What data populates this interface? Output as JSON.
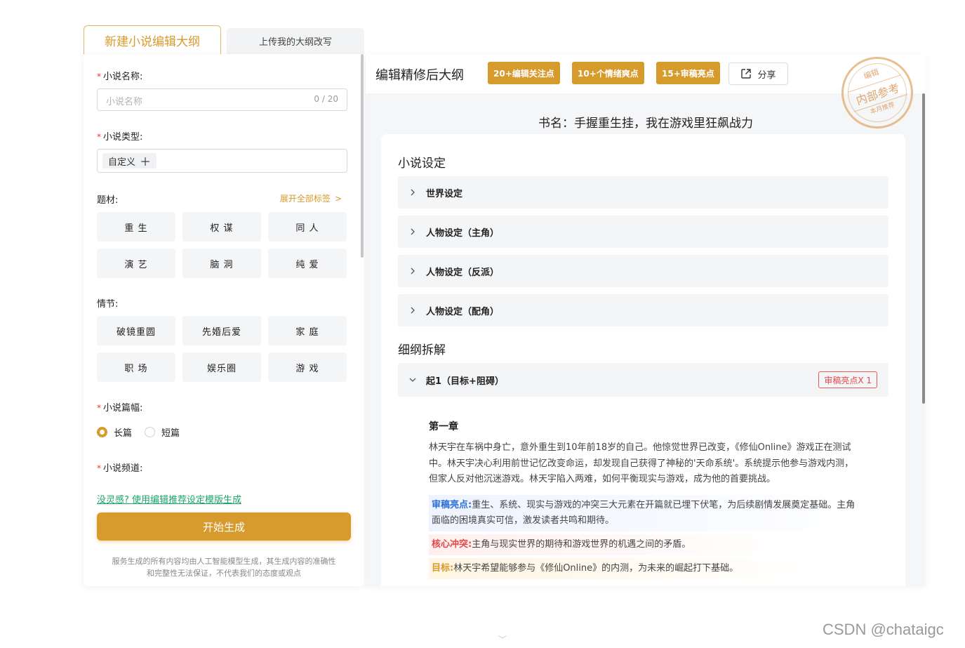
{
  "tabs": {
    "new_outline": "新建小说编辑大纲",
    "upload_outline": "上传我的大纲改写"
  },
  "form": {
    "name_label": "小说名称:",
    "name_placeholder": "小说名称",
    "name_counter": "0 / 20",
    "type_label": "小说类型:",
    "type_chip": "自定义",
    "theme_label": "题材:",
    "expand_tags": "展开全部标签",
    "theme_tags": [
      "重 生",
      "权 谋",
      "同 人",
      "演 艺",
      "脑 洞",
      "纯 爱"
    ],
    "plot_label": "情节:",
    "plot_tags": [
      "破镜重圆",
      "先婚后爱",
      "家 庭",
      "职 场",
      "娱乐圈",
      "游 戏"
    ],
    "length_label": "小说篇幅:",
    "length_options": [
      "长篇",
      "短篇"
    ],
    "length_selected": "长篇",
    "channel_label": "小说频道:",
    "inspire_link": "没灵感? 使用编辑推荐设定模版生成",
    "start_button": "开始生成",
    "disclaimer_line1": "服务生成的所有内容均由人工智能模型生成，其生成内容的准确性",
    "disclaimer_line2": "和完整性无法保证，不代表我们的态度或观点"
  },
  "result": {
    "title": "编辑精修后大纲",
    "badges": [
      "20+编辑关注点",
      "10+个情绪爽点",
      "15+审稿亮点"
    ],
    "share": "分享",
    "stamp": {
      "top": "编辑",
      "middle": "内部参考",
      "bottom": "本月推荐"
    },
    "book_title": "书名：手握重生挂，我在游戏里狂飙战力",
    "setting_section": "小说设定",
    "settings": [
      "世界设定",
      "人物设定（主角）",
      "人物设定（反派）",
      "人物设定（配角）"
    ],
    "breakdown_section": "细纲拆解",
    "stage": "起1（目标+阻碍）",
    "stage_badge": "审稿亮点X 1",
    "chapter_title": "第一章",
    "chapter_body": "林天宇在车祸中身亡，意外重生到10年前18岁的自己。他惊觉世界已改变，《修仙Online》游戏正在测试中。林天宇决心利用前世记忆改变命运，却发现自己获得了神秘的'天命系统'。系统提示他参与游戏内测，但家人反对他沉迷游戏。林天宇陷入两难，如何平衡现实与游戏，成为他的首要挑战。",
    "highlight_label": "审稿亮点:",
    "highlight_text": "重生、系统、现实与游戏的冲突三大元素在开篇就已埋下伏笔，为后续剧情发展奠定基础。主角面临的困境真实可信，激发读者共鸣和期待。",
    "conflict_label": "核心冲突:",
    "conflict_text": "主角与现实世界的期待和游戏世界的机遇之间的矛盾。",
    "goal_label": "目标:",
    "goal_text": "林天宇希望能够参与《修仙Online》的内测，为未来的崛起打下基础。"
  },
  "watermark": "CSDN @chataigc",
  "colors": {
    "accent": "#d69a2d",
    "link_green": "#1aa36b",
    "highlight_blue": "#2d6fd8",
    "conflict_red": "#e24848"
  }
}
